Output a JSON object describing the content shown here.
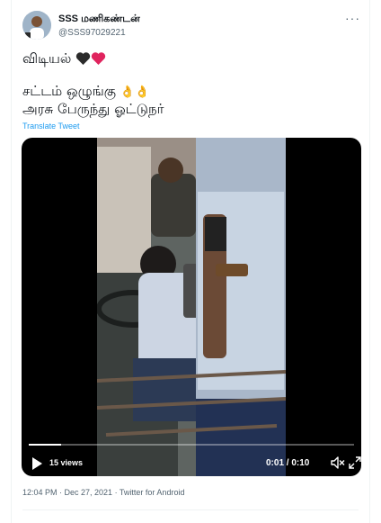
{
  "tweet": {
    "display_name": "SSS மணிகண்டன்",
    "handle": "@SSS97029221",
    "more_icon": "more-icon",
    "text_line1": "விடியல்",
    "hearts": [
      "black-heart-icon",
      "red-heart-icon"
    ],
    "text_line2": "சட்டம் ஒழுங்கு",
    "text_line3": "அரசு பேருந்து ஓட்டுநர்",
    "ok_emoji": "👌👌",
    "translate_label": "Translate Tweet",
    "timestamp": "12:04 PM · Dec 27, 2021",
    "source": "Twitter for Android"
  },
  "video": {
    "views": "15 views",
    "time": "0:01 / 0:10",
    "progress": 0.1,
    "icons": [
      "play-icon",
      "volume-icon",
      "fullscreen-icon"
    ]
  },
  "colors": {
    "link": "#1d9bf0",
    "secondary_text": "#536471",
    "heart_red": "#e0245e"
  }
}
